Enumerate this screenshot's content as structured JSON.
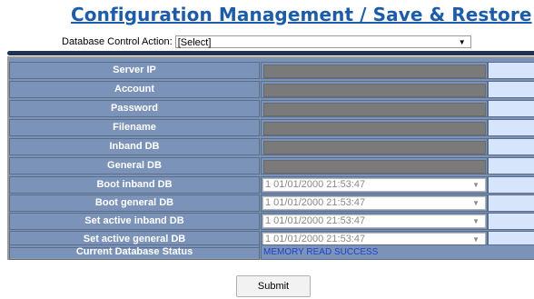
{
  "header": {
    "title": "Configuration Management / Save & Restore"
  },
  "action": {
    "label": "Database Control Action:",
    "value": "[Select]"
  },
  "fields": [
    {
      "label": "Server IP",
      "type": "input",
      "value": ""
    },
    {
      "label": "Account",
      "type": "input",
      "value": ""
    },
    {
      "label": "Password",
      "type": "input",
      "value": ""
    },
    {
      "label": "Filename",
      "type": "input",
      "value": ""
    },
    {
      "label": "Inband DB",
      "type": "input",
      "value": ""
    },
    {
      "label": "General DB",
      "type": "input",
      "value": ""
    },
    {
      "label": "Boot inband DB",
      "type": "select",
      "value": "1 01/01/2000 21:53:47"
    },
    {
      "label": "Boot general DB",
      "type": "select",
      "value": "1 01/01/2000 21:53:47"
    },
    {
      "label": "Set active inband DB",
      "type": "select",
      "value": "1 01/01/2000 21:53:47"
    },
    {
      "label": "Set active general DB",
      "type": "select",
      "value": "1 01/01/2000 21:53:47"
    }
  ],
  "status": {
    "label": "Current Database Status",
    "value": "MEMORY READ SUCCESS"
  },
  "submit": {
    "label": "Submit"
  },
  "colors": {
    "title": "#1c5ca8",
    "panel": "#7b93b8",
    "bar": "#1e3354",
    "status_text": "#1f3fd0"
  }
}
